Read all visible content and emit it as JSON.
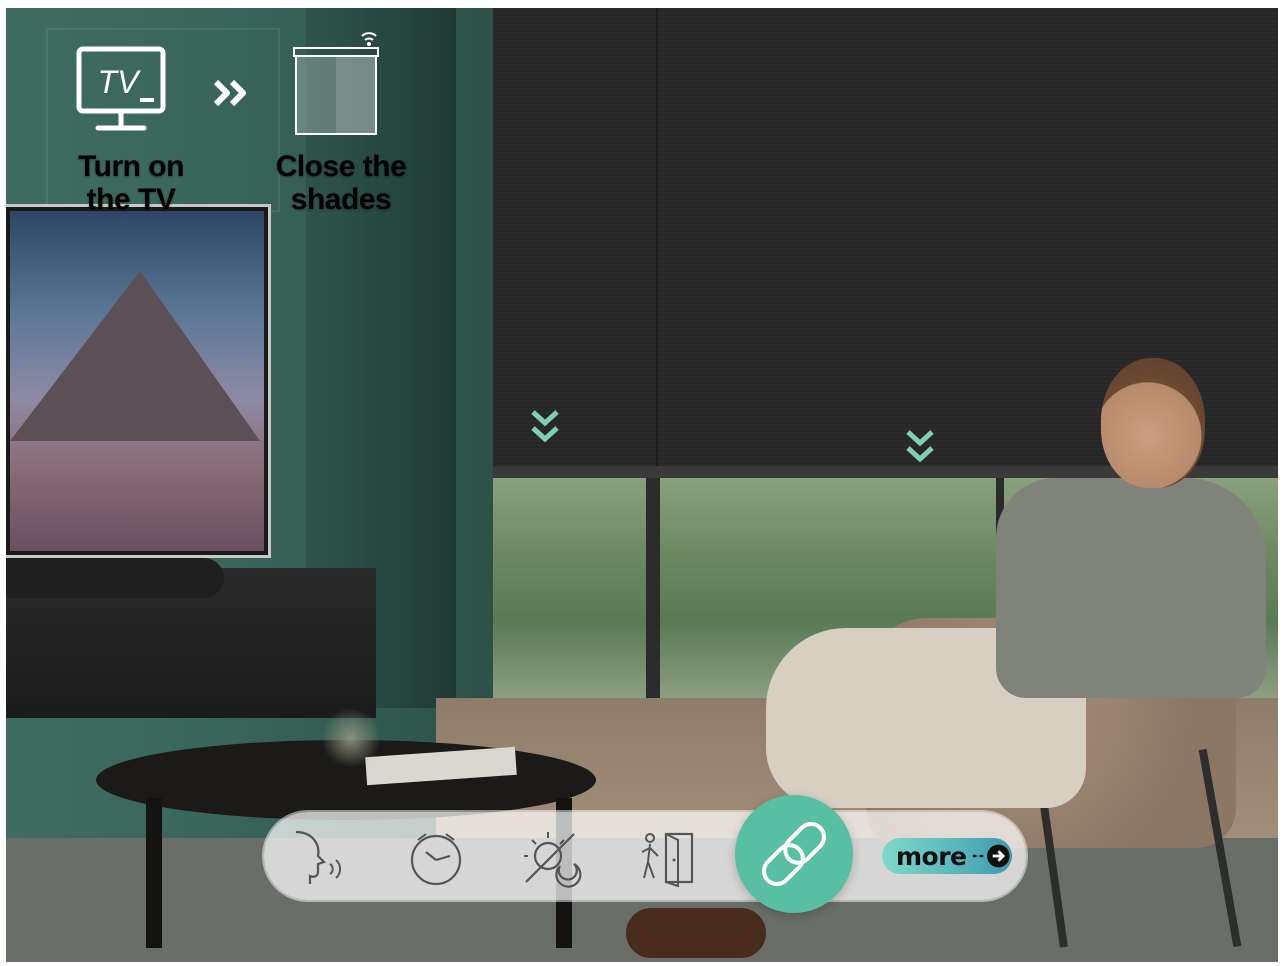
{
  "flow": {
    "step1": {
      "icon": "tv-icon",
      "icon_text": "TV",
      "line1": "Turn on",
      "line2": "the TV"
    },
    "arrow": "double-chevron-right-icon",
    "step2": {
      "icon": "roller-blind-wifi-icon",
      "line1": "Close the",
      "line2": "shades"
    }
  },
  "toolbar": {
    "items": [
      {
        "icon": "voice-control-icon"
      },
      {
        "icon": "clock-icon"
      },
      {
        "icon": "sun-moon-icon"
      },
      {
        "icon": "person-door-icon"
      },
      {
        "icon": "link-icon",
        "active": true
      }
    ],
    "more_label": "more",
    "more_icon": "arrow-right-circle-icon"
  },
  "colors": {
    "accent": "#59bfa3",
    "more_gradient_start": "#7fd9c9",
    "more_gradient_end": "#3f9bb0",
    "text": "#ffffff"
  }
}
